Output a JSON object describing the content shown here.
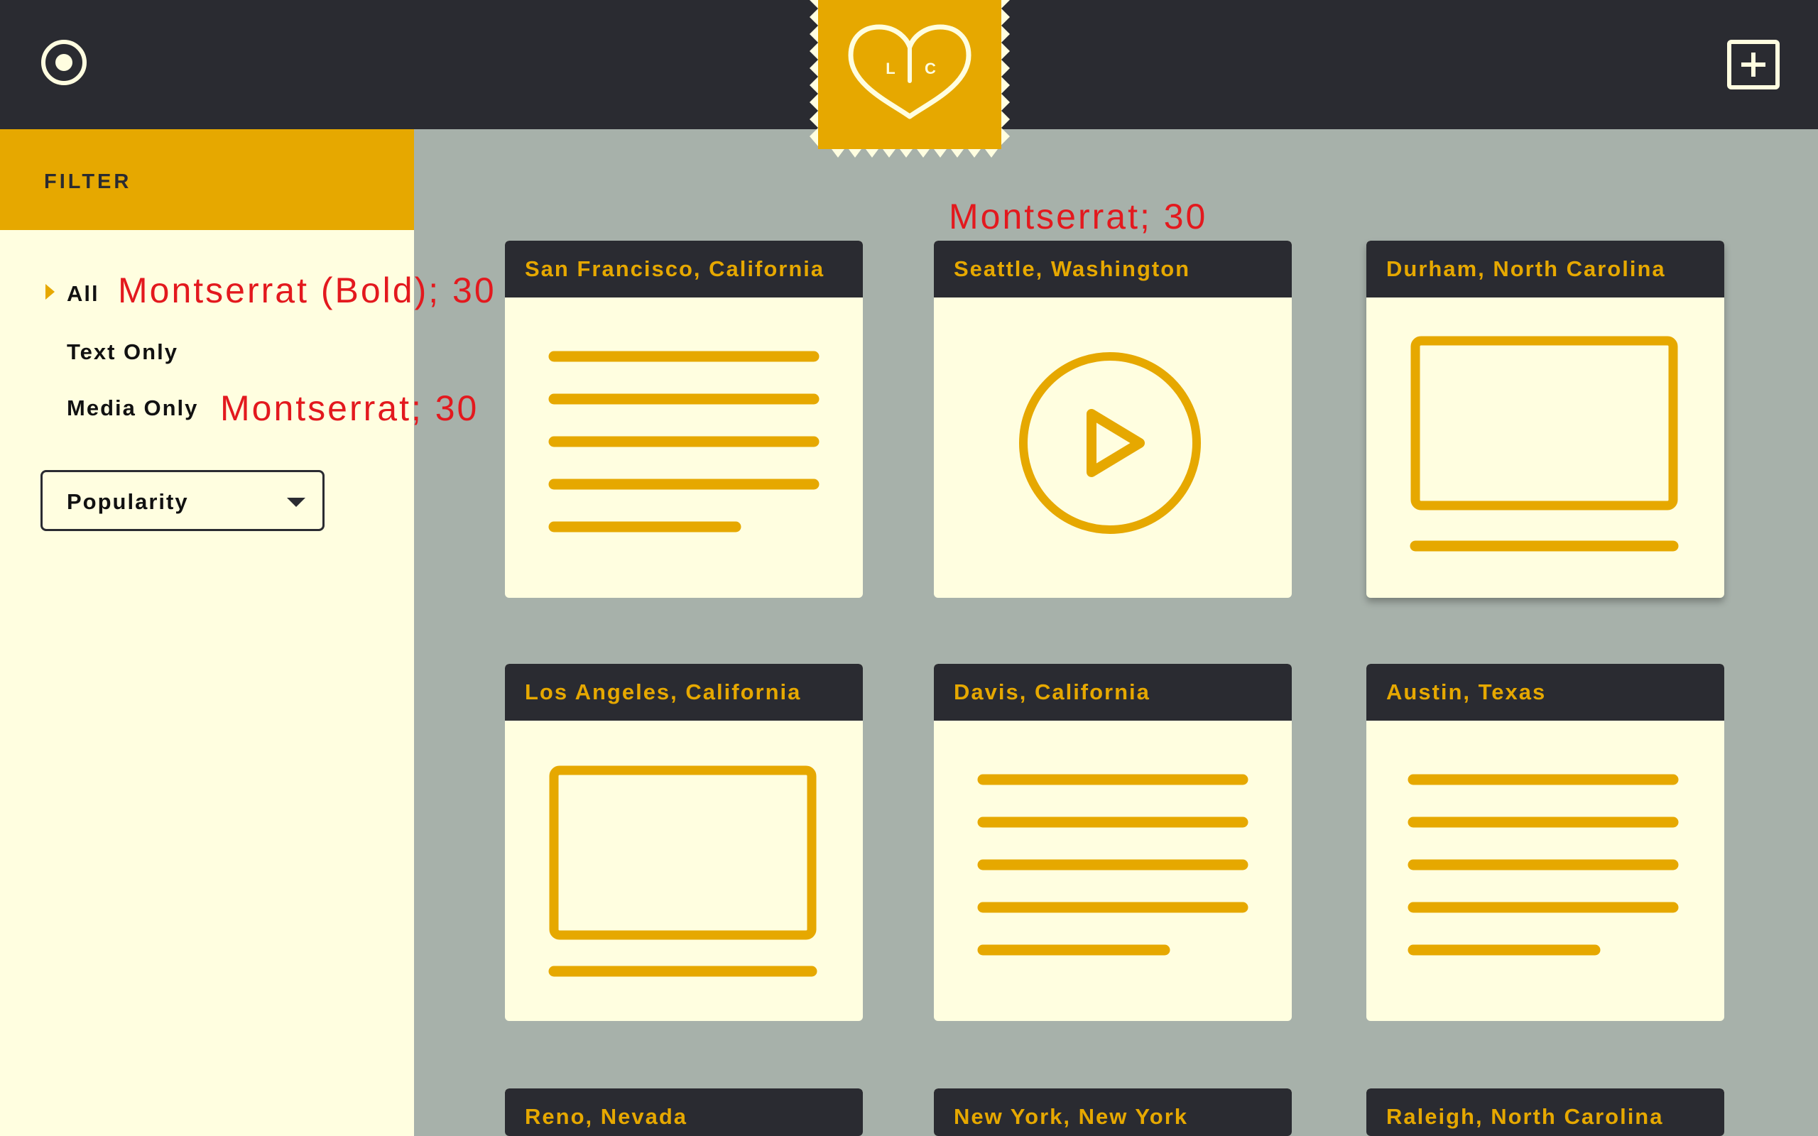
{
  "header": {
    "menu_icon": "radio-circle-icon",
    "logo": {
      "left_letter": "L",
      "right_letter": "C"
    },
    "add_icon": "plus-square-icon"
  },
  "sidebar": {
    "filter_title": "FILTER",
    "options": [
      {
        "label": "All",
        "selected": true
      },
      {
        "label": "Text Only",
        "selected": false
      },
      {
        "label": "Media Only",
        "selected": false
      }
    ],
    "sort": {
      "selected": "Popularity"
    }
  },
  "annotations": {
    "all_option": "Montserrat (Bold); 30",
    "media_option": "Montserrat; 30",
    "card_title": "Montserrat; 30"
  },
  "cards": [
    {
      "title": "San Francisco, California",
      "type": "text"
    },
    {
      "title": "Seattle, Washington",
      "type": "video"
    },
    {
      "title": "Durham, North Carolina",
      "type": "image"
    },
    {
      "title": "Los Angeles, California",
      "type": "image"
    },
    {
      "title": "Davis, California",
      "type": "text"
    },
    {
      "title": "Austin, Texas",
      "type": "text"
    },
    {
      "title": "Reno, Nevada"
    },
    {
      "title": "New York, New York"
    },
    {
      "title": "Raleigh, North Carolina"
    }
  ],
  "colors": {
    "dark": "#2a2b31",
    "accent": "#e6a800",
    "cream": "#fffee0",
    "background": "#a7b1aa",
    "annotation": "#e3191e"
  }
}
